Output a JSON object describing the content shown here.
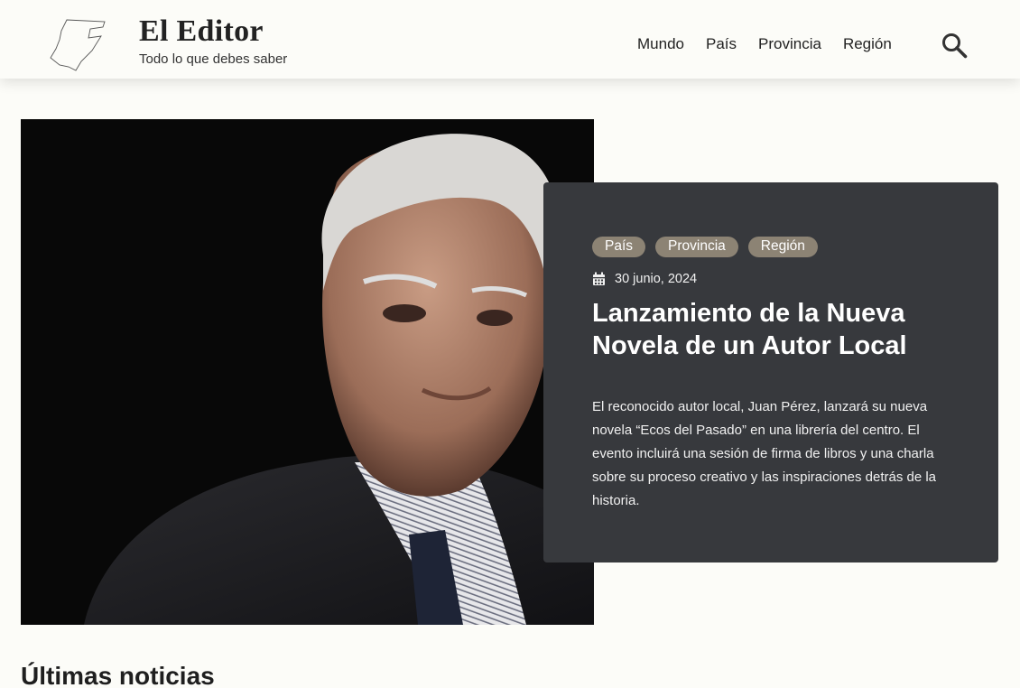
{
  "header": {
    "title": "El Editor",
    "tagline": "Todo lo que debes saber",
    "logo_icon": "map-outline-icon",
    "nav": [
      "Mundo",
      "País",
      "Provincia",
      "Región"
    ],
    "search_icon": "search-icon"
  },
  "featured": {
    "image_alt": "Retrato de un hombre mayor de cabello blanco con traje oscuro",
    "tags": [
      "País",
      "Provincia",
      "Región"
    ],
    "date_icon": "calendar-icon",
    "date": "30 junio, 2024",
    "title": "Lanzamiento de la Nueva Novela de un Autor Local",
    "excerpt": "El reconocido autor local, Juan Pérez, lanzará su nueva novela “Ecos del Pasado” en una librería del centro. El evento incluirá una sesión de firma de libros y una charla sobre su proceso creativo y las inspiraciones detrás de la historia."
  },
  "latest": {
    "title": "Últimas noticias"
  },
  "colors": {
    "background": "#fcfcf8",
    "card": "#37393d",
    "tag": "#8c8374"
  }
}
